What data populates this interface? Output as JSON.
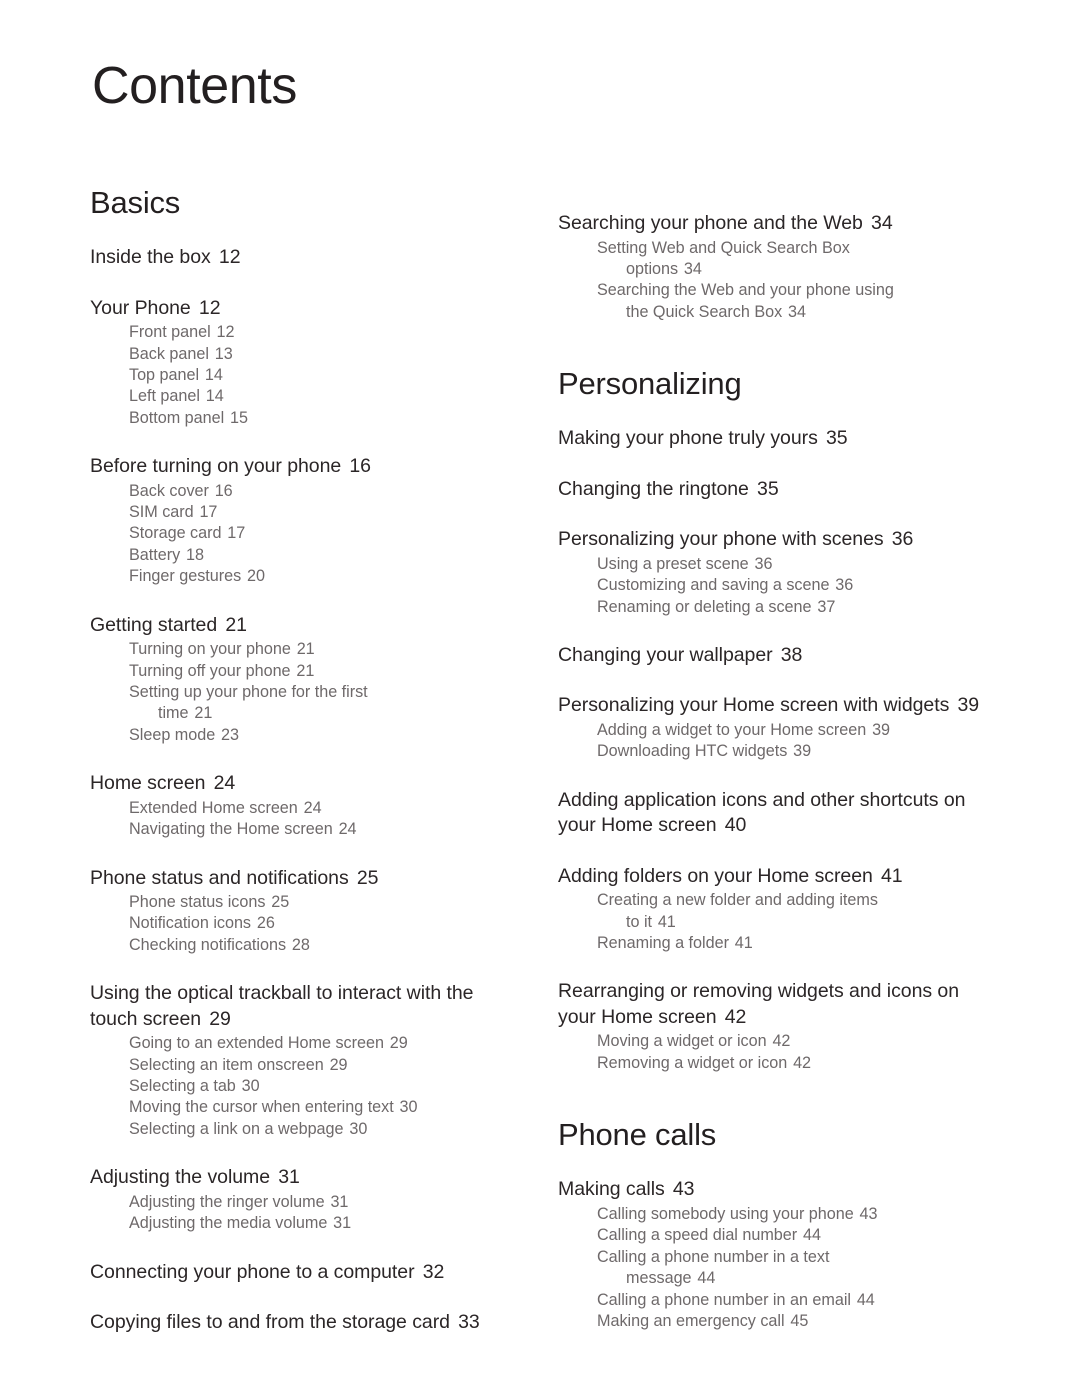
{
  "document": {
    "title": "Contents",
    "colors": {
      "heading": "#231f20",
      "entry_level1": "#2b2627",
      "entry_level2": "#6e696a",
      "background": "#ffffff"
    }
  },
  "columns": [
    {
      "id": "left-column",
      "sections": [
        {
          "heading": "Basics",
          "entries": [
            {
              "label": "Inside the box",
              "page": "12",
              "children": []
            },
            {
              "label": "Your Phone",
              "page": "12",
              "children": [
                {
                  "label": "Front panel",
                  "page": "12"
                },
                {
                  "label": "Back panel",
                  "page": "13"
                },
                {
                  "label": "Top panel",
                  "page": "14"
                },
                {
                  "label": "Left panel",
                  "page": "14"
                },
                {
                  "label": "Bottom panel",
                  "page": "15"
                }
              ]
            },
            {
              "label": "Before turning on your phone",
              "page": "16",
              "children": [
                {
                  "label": "Back cover",
                  "page": "16"
                },
                {
                  "label": "SIM card",
                  "page": "17"
                },
                {
                  "label": "Storage card",
                  "page": "17"
                },
                {
                  "label": "Battery",
                  "page": "18"
                },
                {
                  "label": "Finger gestures",
                  "page": "20"
                }
              ]
            },
            {
              "label": "Getting started",
              "page": "21",
              "children": [
                {
                  "label": "Turning on your phone",
                  "page": "21"
                },
                {
                  "label": "Turning off your phone",
                  "page": "21"
                },
                {
                  "label": "Setting up your phone for the first",
                  "wrap": "time",
                  "page": "21"
                },
                {
                  "label": "Sleep mode",
                  "page": "23"
                }
              ]
            },
            {
              "label": "Home screen",
              "page": "24",
              "children": [
                {
                  "label": "Extended Home screen",
                  "page": "24"
                },
                {
                  "label": "Navigating the Home screen",
                  "page": "24"
                }
              ]
            },
            {
              "label": "Phone status and notifications",
              "page": "25",
              "children": [
                {
                  "label": "Phone status icons",
                  "page": "25"
                },
                {
                  "label": "Notification icons",
                  "page": "26"
                },
                {
                  "label": "Checking notifications",
                  "page": "28"
                }
              ]
            },
            {
              "label": "Using the optical trackball to interact with the touch screen",
              "page": "29",
              "children": [
                {
                  "label": "Going to an extended Home screen",
                  "page": "29"
                },
                {
                  "label": "Selecting an item onscreen",
                  "page": "29"
                },
                {
                  "label": "Selecting a tab",
                  "page": "30"
                },
                {
                  "label": "Moving the cursor when entering text",
                  "page": "30"
                },
                {
                  "label": "Selecting a link on a webpage",
                  "page": "30"
                }
              ]
            },
            {
              "label": "Adjusting the volume",
              "page": "31",
              "children": [
                {
                  "label": "Adjusting the ringer volume",
                  "page": "31"
                },
                {
                  "label": "Adjusting the media volume",
                  "page": "31"
                }
              ]
            },
            {
              "label": "Connecting your phone to a computer",
              "page": "32",
              "children": []
            },
            {
              "label": "Copying files to and from the storage card",
              "page": "33",
              "children": []
            }
          ]
        }
      ]
    },
    {
      "id": "right-column",
      "sections": [
        {
          "heading": null,
          "entries": [
            {
              "label": "Searching your phone and the Web",
              "page": "34",
              "children": [
                {
                  "label": "Setting Web and Quick Search Box",
                  "wrap": "options",
                  "page": "34"
                },
                {
                  "label": "Searching the Web and your phone using",
                  "wrap": "the Quick Search Box",
                  "page": "34"
                }
              ]
            }
          ]
        },
        {
          "heading": "Personalizing",
          "entries": [
            {
              "label": "Making your phone truly yours",
              "page": "35",
              "children": []
            },
            {
              "label": "Changing the ringtone",
              "page": "35",
              "children": []
            },
            {
              "label": "Personalizing your phone with scenes",
              "page": "36",
              "children": [
                {
                  "label": "Using a preset scene",
                  "page": "36"
                },
                {
                  "label": "Customizing and saving a scene",
                  "page": "36"
                },
                {
                  "label": "Renaming or deleting a scene",
                  "page": "37"
                }
              ]
            },
            {
              "label": "Changing your wallpaper",
              "page": "38",
              "children": []
            },
            {
              "label": "Personalizing your Home screen with widgets",
              "page": "39",
              "children": [
                {
                  "label": "Adding a widget to your Home screen",
                  "page": "39"
                },
                {
                  "label": "Downloading HTC widgets",
                  "page": "39"
                }
              ]
            },
            {
              "label": "Adding application icons and other shortcuts on your Home screen",
              "page": "40",
              "children": []
            },
            {
              "label": "Adding folders on your Home screen",
              "page": "41",
              "children": [
                {
                  "label": "Creating a new folder and adding items",
                  "wrap": "to it",
                  "page": "41"
                },
                {
                  "label": "Renaming a folder",
                  "page": "41"
                }
              ]
            },
            {
              "label": "Rearranging or removing widgets and icons on your Home screen",
              "page": "42",
              "children": [
                {
                  "label": "Moving a widget or icon",
                  "page": "42"
                },
                {
                  "label": "Removing a widget or icon",
                  "page": "42"
                }
              ]
            }
          ]
        },
        {
          "heading": "Phone calls",
          "entries": [
            {
              "label": "Making calls",
              "page": "43",
              "children": [
                {
                  "label": "Calling somebody using your phone",
                  "page": "43"
                },
                {
                  "label": "Calling a speed dial number",
                  "page": "44"
                },
                {
                  "label": "Calling a phone number in a text",
                  "wrap": "message",
                  "page": "44"
                },
                {
                  "label": "Calling a phone number in an email",
                  "page": "44"
                },
                {
                  "label": "Making an emergency call",
                  "page": "45"
                }
              ]
            }
          ]
        }
      ]
    }
  ]
}
